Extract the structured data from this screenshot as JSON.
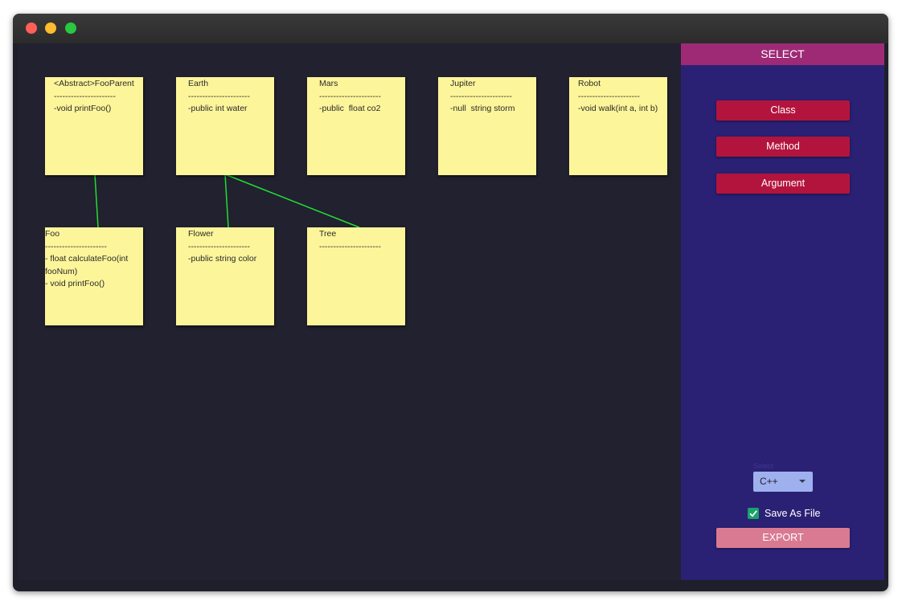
{
  "window": {
    "controls": [
      "close",
      "minimize",
      "zoom"
    ]
  },
  "diagram": {
    "notes": [
      {
        "id": "fooparent",
        "title": "<Abstract>FooParent",
        "separator": "----------------------",
        "members": [
          "-void printFoo()"
        ]
      },
      {
        "id": "earth",
        "title": "Earth",
        "separator": "----------------------",
        "members": [
          "-public int water"
        ]
      },
      {
        "id": "mars",
        "title": "Mars",
        "separator": "----------------------",
        "members": [
          "-public  float co2"
        ]
      },
      {
        "id": "jupiter",
        "title": "Jupiter",
        "separator": "----------------------",
        "members": [
          "-null  string storm"
        ]
      },
      {
        "id": "robot",
        "title": "Robot",
        "separator": "----------------------",
        "members": [
          "-void walk(int a, int b)"
        ]
      },
      {
        "id": "foo",
        "title": "Foo",
        "separator": "----------------------",
        "members": [
          "- float calculateFoo(int",
          "fooNum)",
          "- void printFoo()"
        ]
      },
      {
        "id": "flower",
        "title": "Flower",
        "separator": "----------------------",
        "members": [
          "-public string color"
        ]
      },
      {
        "id": "tree",
        "title": "Tree",
        "separator": "----------------------",
        "members": []
      }
    ],
    "links": [
      {
        "from": "fooparent",
        "to": "foo"
      },
      {
        "from": "earth",
        "to": "flower"
      },
      {
        "from": "earth",
        "to": "tree"
      }
    ],
    "link_color": "#22dd33"
  },
  "panel": {
    "header": "SELECT",
    "buttons": {
      "class": "Class",
      "method": "Method",
      "argument": "Argument"
    },
    "language_select": {
      "label": "Select",
      "value": "C++"
    },
    "save_as_file": {
      "label": "Save As File",
      "checked": true
    },
    "export_label": "EXPORT",
    "colors": {
      "panel_bg": "#2a2175",
      "header_bg": "#9e2a76",
      "button_bg": "#b3143e",
      "export_bg": "#d97a92"
    }
  }
}
